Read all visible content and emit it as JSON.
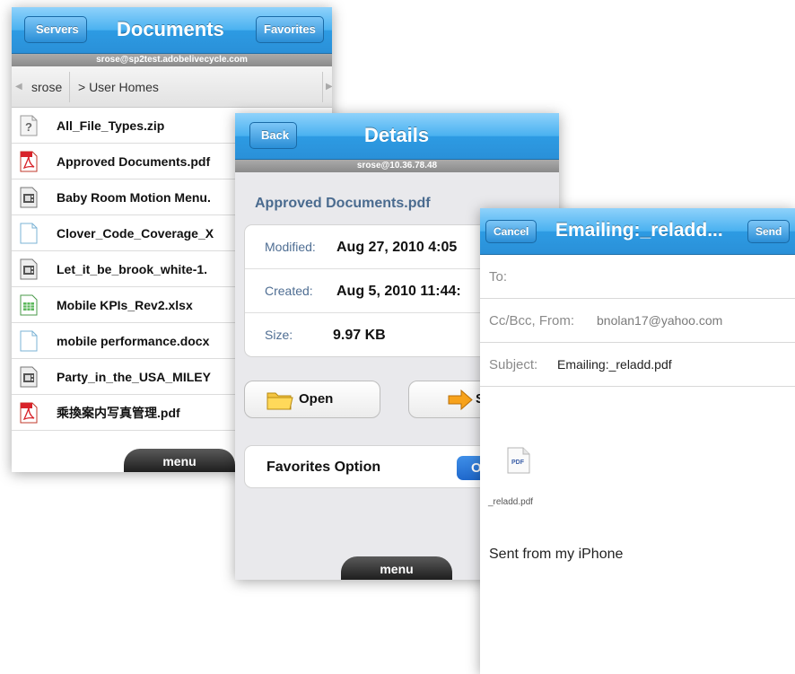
{
  "documents": {
    "nav": {
      "back_label": "Servers",
      "title": "Documents",
      "favorites_label": "Favorites"
    },
    "account": "srose@sp2test.adobelivecycle.com",
    "breadcrumb": {
      "root": "srose",
      "current": "> User Homes"
    },
    "files": [
      {
        "name": "All_File_Types.zip",
        "icon": "question-file-icon"
      },
      {
        "name": "Approved Documents.pdf",
        "icon": "pdf-file-icon"
      },
      {
        "name": "Baby Room Motion Menu.",
        "icon": "video-file-icon"
      },
      {
        "name": "Clover_Code_Coverage_X",
        "icon": "blank-file-icon"
      },
      {
        "name": "Let_it_be_brook_white-1.",
        "icon": "video-file-icon"
      },
      {
        "name": "Mobile KPIs_Rev2.xlsx",
        "icon": "spreadsheet-file-icon"
      },
      {
        "name": "mobile performance.docx",
        "icon": "blank-file-icon"
      },
      {
        "name": "Party_in_the_USA_MILEY",
        "icon": "video-file-icon"
      },
      {
        "name": "乘換案内写真管理.pdf",
        "icon": "pdf-file-icon"
      }
    ],
    "menu_label": "menu"
  },
  "details": {
    "nav": {
      "back_label": "Back",
      "title": "Details"
    },
    "account": "srose@10.36.78.48",
    "filename": "Approved Documents.pdf",
    "info": [
      {
        "label": "Modified:",
        "value": "Aug 27, 2010 4:05"
      },
      {
        "label": "Created:",
        "value": "Aug 5, 2010 11:44:"
      },
      {
        "label": "Size:",
        "value": "9.97 KB"
      }
    ],
    "open_label": "Open",
    "share_label": "S",
    "favorites_option_label": "Favorites Option",
    "toggle_label": "O",
    "menu_label": "menu"
  },
  "email": {
    "nav": {
      "cancel_label": "Cancel",
      "title": "Emailing:_reladd...",
      "send_label": "Send"
    },
    "to_label": "To:",
    "ccbcc_label": "Cc/Bcc, From:",
    "from_value": "bnolan17@yahoo.com",
    "subject_label": "Subject:",
    "subject_value": "Emailing:_reladd.pdf",
    "attachment_badge": "PDF",
    "attachment_name": "_reladd.pdf",
    "signature": "Sent from my iPhone"
  },
  "colors": {
    "nav_blue": "#2d9be3",
    "label_blue": "#4f6e93",
    "toggle_blue": "#1f68cc",
    "pdf_red": "#d8232a"
  }
}
